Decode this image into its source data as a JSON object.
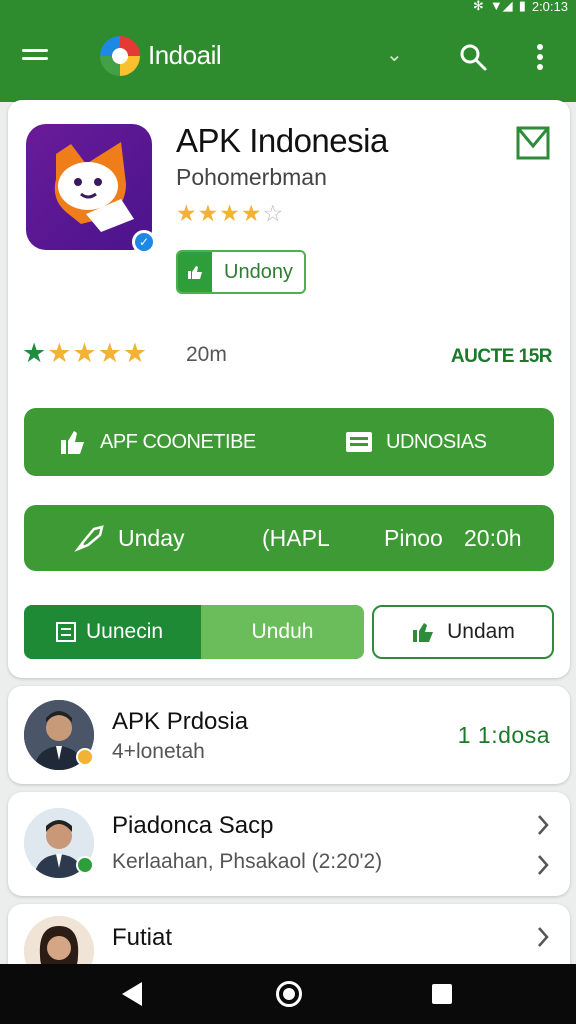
{
  "status_bar": {
    "time": "2:0:13"
  },
  "app_bar": {
    "title": "Indoail"
  },
  "app": {
    "title": "APK Indonesia",
    "subtitle": "Pohomerbman",
    "rating_stars": 4,
    "install_button": "Undony"
  },
  "stats": {
    "rating_stars": 5,
    "review_count": "20m",
    "age_rating": "AUCTE 15R"
  },
  "actions_row": {
    "left_label": "APF COONETIBE",
    "right_label": "UDNOSIAS"
  },
  "info_row": {
    "label_1": "Unday",
    "label_2": "(HAPL",
    "label_3": "Pinoo",
    "label_4": "20:0h"
  },
  "tabs": [
    {
      "label": "Uunecin",
      "active": true
    },
    {
      "label": "Unduh",
      "active": false
    }
  ],
  "outline_button": "Undam",
  "list": [
    {
      "name": "APK Prdosia",
      "subtext": "4+lonetah",
      "time": "1 1:dosa"
    },
    {
      "name": "Piadonca Sacp",
      "subtext": "Kerlaahan, Phsakaol  (2:20'2)",
      "time": ""
    },
    {
      "name": "Futiat",
      "subtext": "",
      "time": ""
    }
  ],
  "colors": {
    "primary": "#2e8b2e",
    "accent_green": "#3d9a34",
    "star_yellow": "#f2b233",
    "star_green": "#1e8e3e",
    "nav_bar": "#0a0a0a"
  }
}
